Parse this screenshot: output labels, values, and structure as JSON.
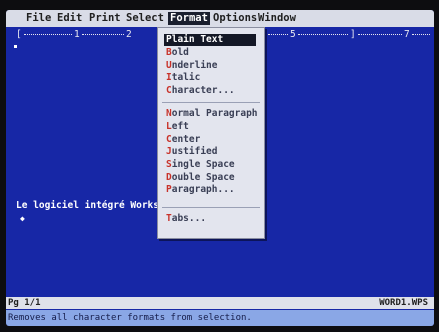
{
  "menubar": {
    "items": [
      {
        "label": "File",
        "hot": "F"
      },
      {
        "label": "Edit",
        "hot": "E"
      },
      {
        "label": "Print",
        "hot": "P"
      },
      {
        "label": "Select",
        "hot": "S"
      },
      {
        "label": "Format",
        "hot": "o",
        "active": true
      },
      {
        "label": "Options",
        "hot": "O"
      },
      {
        "label": "Window",
        "hot": "W"
      }
    ]
  },
  "ruler": {
    "start": "[",
    "end": "]",
    "numbers": [
      "1",
      "2",
      "5",
      "7"
    ]
  },
  "format_menu": {
    "items": [
      {
        "label": "Plain Text",
        "selected": true
      },
      {
        "label": "Bold"
      },
      {
        "label": "Underline"
      },
      {
        "label": "Italic"
      },
      {
        "label": "Character..."
      },
      {
        "separator": true
      },
      {
        "label": "Normal Paragraph"
      },
      {
        "label": "Left"
      },
      {
        "label": "Center"
      },
      {
        "label": "Justified"
      },
      {
        "label": "Single Space"
      },
      {
        "label": "Double Space"
      },
      {
        "label": "Paragraph..."
      },
      {
        "separator": true
      },
      {
        "label": "Tabs..."
      }
    ]
  },
  "document": {
    "text": "Le logiciel intégré Works",
    "end_marker": "◆"
  },
  "status": {
    "page": "Pg 1/1",
    "filename": "WORD1.WPS"
  },
  "message": "Removes all character formats from selection.",
  "colors": {
    "screen_background": "#1727a6",
    "menu_background": "#d9dce7",
    "hotkey": "#c8322a",
    "message_bar": "#8aa7e6"
  }
}
